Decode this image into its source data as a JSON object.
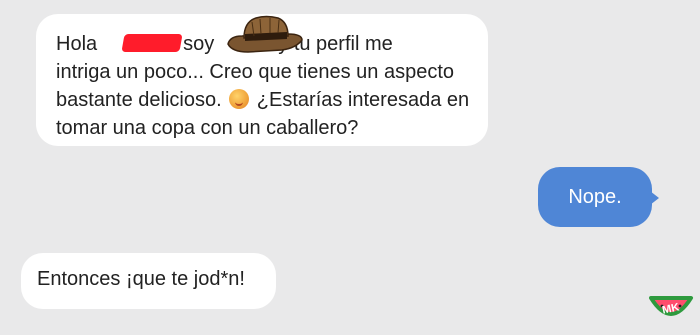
{
  "conversation": {
    "incoming_1": {
      "line1_a": "Hola",
      "line1_b": "soy",
      "line1_c": "y tu perfil me",
      "line2": "intriga un poco... Creo que tienes un aspecto",
      "line3_a": "bastante delicioso.",
      "line3_b": "¿Estarías interesada en",
      "line4": "tomar una copa con un caballero?"
    },
    "outgoing_1": {
      "text": "Nope."
    },
    "incoming_2": {
      "text": "Entonces ¡que te jod*n!"
    }
  },
  "watermark": {
    "text": "MK"
  },
  "colors": {
    "background": "#e9e9ea",
    "incoming_bubble": "#ffffff",
    "outgoing_bubble": "#4f86d6",
    "redaction": "#ff1c2b"
  }
}
